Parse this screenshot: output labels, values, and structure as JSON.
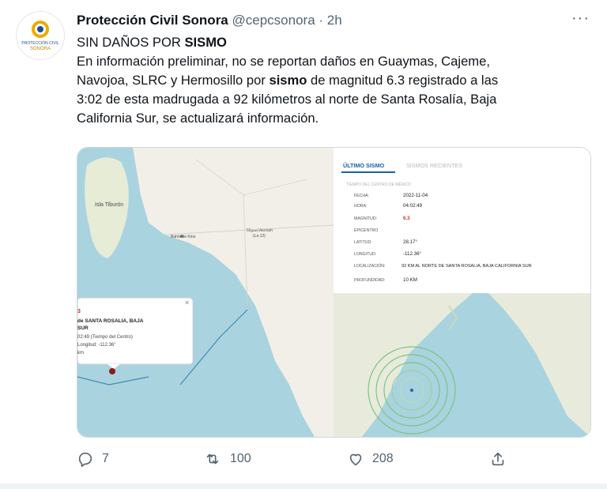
{
  "tweet": {
    "author_name": "Protección Civil Sonora",
    "handle": "@cepcsonora",
    "separator": "·",
    "time": "2h",
    "more": "···",
    "text_line1_prefix": "SIN DAÑOS POR ",
    "text_line1_bold": "SISMO",
    "text_p1": "En información preliminar, no se reportan daños en Guaymas, Cajeme,",
    "text_p2a": "Navojoa, SLRC y Hermosillo por ",
    "text_p2_bold": "sismo",
    "text_p2b": " de magnitud 6.3 registrado a las",
    "text_p3": "3:02 de esta madrugada a 92 kilómetros al norte de Santa Rosalía, Baja",
    "text_p4": "California Sur, se actualizará información."
  },
  "avatar": {
    "logo_text_1": "PROTECCIÓN CIVIL",
    "logo_text_2": "SONORA"
  },
  "map_left": {
    "label_island": "Isla Tiburón",
    "label_town1": "Bahía de Kino",
    "label_town2": "Miguel Alemán",
    "label_town2_sub": "(La 12)",
    "popup_title": "3",
    "popup_line1": "de SANTA ROSALIA, BAJA",
    "popup_line2": "SUR",
    "popup_line3": "02:49 (Tiempo del Centro)",
    "popup_line4": "Longitud: -112.36°",
    "popup_line5": "km",
    "popup_close": "×"
  },
  "panel": {
    "tab_active": "ÚLTIMO SISMO",
    "tab_inactive": "SISMOS RECIENTES",
    "subtitle": "TIEMPO DEL CENTRO DE MÉXICO",
    "rows": [
      {
        "label": "FECHA:",
        "value": "2022-11-04"
      },
      {
        "label": "HORA:",
        "value": "04:02:49"
      },
      {
        "label": "MAGNITUD:",
        "value": "6.3"
      },
      {
        "label": "EPICENTRO",
        "value": ""
      },
      {
        "label": "LATITUD:",
        "value": "28.17°"
      },
      {
        "label": "LONGITUD:",
        "value": "-112.36°"
      },
      {
        "label": "LOCALIZACIÓN:",
        "value": "92 KM AL NORTE DE SANTA ROSALIA, BAJA CALIFORNIA SUR"
      },
      {
        "label": "PROFUNDIDAD:",
        "value": "10 KM"
      }
    ]
  },
  "actions": {
    "reply_count": "7",
    "retweet_count": "100",
    "like_count": "208"
  },
  "colors": {
    "sea": "#a9d3df",
    "land": "#f2efe9",
    "magnitude": "#c0392b",
    "accent_tab": "#1a5fa8"
  }
}
